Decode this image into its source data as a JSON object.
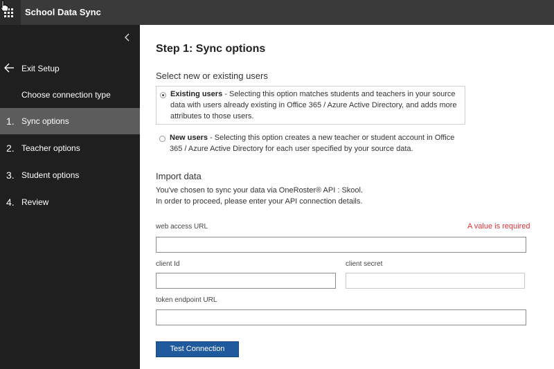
{
  "app": {
    "title": "School Data Sync"
  },
  "sidebar": {
    "exit_label": "Exit Setup",
    "choose_label": "Choose connection type",
    "steps": [
      {
        "num": "1.",
        "label": "Sync options",
        "active": true
      },
      {
        "num": "2.",
        "label": "Teacher options",
        "active": false
      },
      {
        "num": "3.",
        "label": "Student options",
        "active": false
      },
      {
        "num": "4.",
        "label": "Review",
        "active": false
      }
    ]
  },
  "main": {
    "heading": "Step 1: Sync options",
    "users_heading": "Select new or existing users",
    "options": [
      {
        "title": "Existing users",
        "text": " - Selecting this option matches students and teachers in your source data with users already existing in Office 365 / Azure Active Directory, and adds more attributes to those users.",
        "selected": true
      },
      {
        "title": "New users",
        "text": " - Selecting this option creates a new teacher or student account in Office 365 / Azure Active Directory for each user specified by your source data.",
        "selected": false
      }
    ],
    "import_heading": "Import data",
    "import_line1": "You've chosen to sync your data via OneRoster® API : Skool.",
    "import_line2": "In order to proceed, please enter your API connection details.",
    "fields": {
      "web_url_label": "web access URL",
      "web_url_value": "",
      "required_msg": "A value is required",
      "client_id_label": "client Id",
      "client_id_value": "",
      "client_secret_label": "client secret",
      "client_secret_value": "",
      "token_url_label": "token endpoint URL",
      "token_url_value": ""
    },
    "test_button": "Test Connection"
  }
}
